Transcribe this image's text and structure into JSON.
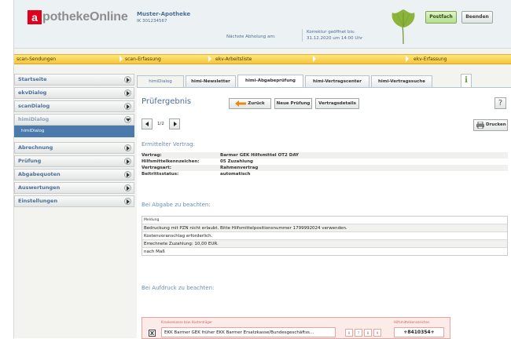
{
  "header": {
    "logo_letter": "a",
    "logo_text": "potheke",
    "logo_text_bold": "Online",
    "pharmacy_name": "Muster-Apotheke",
    "pharmacy_ik": "IK 301234567",
    "next_pickup_label": "Nächste Abholung am:",
    "correction_line1": "Korrektur geöffnet bis:",
    "correction_line2": "31.12.2020 um 14:00 Uhr",
    "mailbox_button": "Postfach",
    "quit_button": "Beenden"
  },
  "top_nav": [
    {
      "label": "scan-Sendungen"
    },
    {
      "label": "scan-Erfassung"
    },
    {
      "label": "ekv-Arbeitsliste"
    },
    {
      "label": "ekv-Erfassung"
    }
  ],
  "sidebar": {
    "items": [
      {
        "label": "Startseite"
      },
      {
        "label": "ekvDialog"
      },
      {
        "label": "scanDialog"
      },
      {
        "label": "himiDialog"
      },
      {
        "label": "Abrechnung"
      },
      {
        "label": "Prüfung"
      },
      {
        "label": "Abgabequoten"
      },
      {
        "label": "Auswertungen"
      },
      {
        "label": "Einstellungen"
      }
    ],
    "sub_item": "himiDialog"
  },
  "tabs": [
    {
      "label": "himiDialog"
    },
    {
      "label": "himi-Newsletter"
    },
    {
      "label": "himi-Abgabeprüfung"
    },
    {
      "label": "himi-Vertragscenter"
    },
    {
      "label": "himi-Vertragssuche"
    }
  ],
  "tab_info_icon": "i",
  "panel": {
    "title": "Prüfergebnis",
    "back_button": "Zurück",
    "new_check_button": "Neue Prüfung",
    "contract_details_button": "Vertragsdetails",
    "help_label": "?",
    "page_indicator": "1/2",
    "print_button": "Drucken",
    "contract_section_title": "Ermittelter Vertrag:",
    "contract": [
      {
        "key": "Vertrag:",
        "value": "Barmer GEK Hilfsmittel OT2 DAY"
      },
      {
        "key": "Hilfsmittelkennzeichen:",
        "value": "05 Zuzahlung"
      },
      {
        "key": "Vertragsart:",
        "value": "Rahmenvertrag"
      },
      {
        "key": "Beitrittsstatus:",
        "value": "automatisch"
      }
    ],
    "notes_section_title": "Bei Abgabe zu beachten:",
    "notes_header": "Meldung",
    "notes": [
      "Bedruckung mit PZN nicht erlaubt. Bitte Hilfsmittelpositionsnummer 1799992024 verwenden.",
      "Kostenvoranschlag erforderlich.",
      "Errechnete Zuzahlung: 10,00 EUR.",
      "nach Maß"
    ],
    "print_section_title": "Bei Aufdruck zu beachten:"
  },
  "form_preview": {
    "header_label": "Krankenkasse bzw. Kostenträger",
    "mark": "X",
    "insurer": "EKK Barmer GEK früher EKK Barmer Ersatzkasse/Bundesgeschäftss...",
    "cells": [
      "6",
      "7",
      "8",
      "9"
    ],
    "number_label": "Hilfsmittelkennzeichen",
    "number": "+8410354+",
    "row2_label": "Name, Vorname des Versicherten"
  },
  "colors": {
    "brand_red": "#e3001b",
    "nav_yellow": "#f4c63d",
    "link_blue": "#4a6f97",
    "selected_blue": "#4b7bad",
    "mailbox_green": "#b7df8d"
  },
  "icons": [
    "ginkgo-leaf-icon",
    "arrow-left-icon",
    "arrow-right-icon",
    "help-icon",
    "printer-icon",
    "info-icon",
    "chevron-right-icon",
    "chevron-down-icon"
  ]
}
